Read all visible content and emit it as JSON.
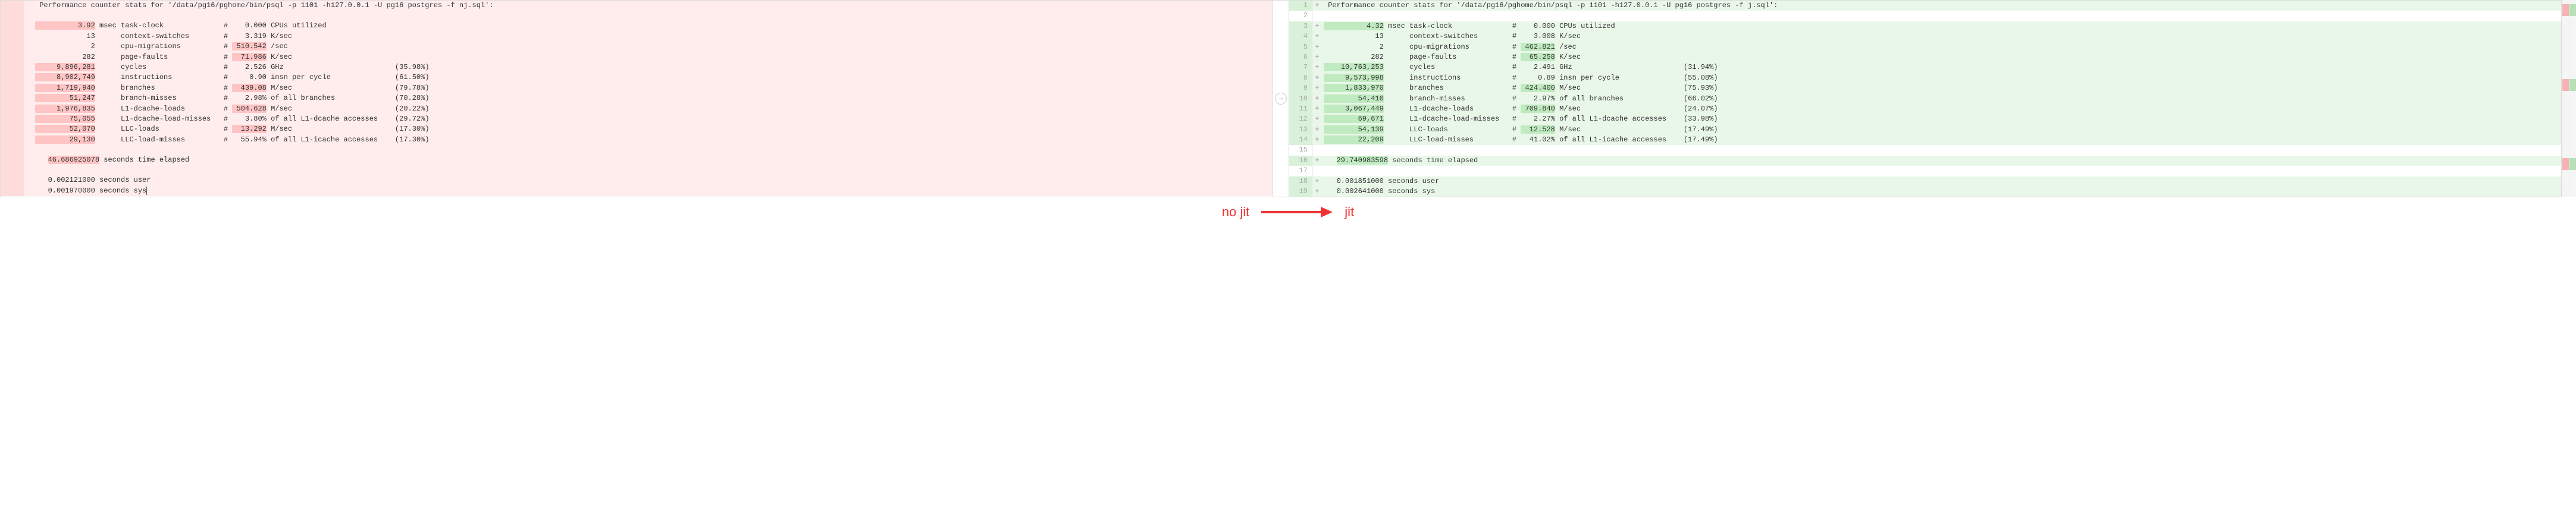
{
  "left": {
    "header": "Performance counter stats for '/data/pg16/pghome/bin/psql -p 1101 -h127.0.0.1 -U pg16 postgres -f nj.sql':",
    "rows": [
      {
        "v1": "3.92",
        "u1": "msec",
        "name": "task-clock",
        "sep": "#",
        "v2": "0.000",
        "u2": "CPUs utilized",
        "pct": "",
        "hl": true
      },
      {
        "v1": "13",
        "u1": "",
        "name": "context-switches",
        "sep": "#",
        "v2": "3.319",
        "u2": "K/sec",
        "pct": ""
      },
      {
        "v1": "2",
        "u1": "",
        "name": "cpu-migrations",
        "sep": "#",
        "v2": "510.542",
        "u2": "/sec",
        "pct": "",
        "hl2": true
      },
      {
        "v1": "282",
        "u1": "",
        "name": "page-faults",
        "sep": "#",
        "v2": "71.986",
        "u2": "K/sec",
        "pct": "",
        "hl2": true
      },
      {
        "v1": "9,896,281",
        "u1": "",
        "name": "cycles",
        "sep": "#",
        "v2": "2.526",
        "u2": "GHz",
        "pct": "(35.98%)",
        "hl": true
      },
      {
        "v1": "8,902,749",
        "u1": "",
        "name": "instructions",
        "sep": "#",
        "v2": "0.90",
        "u2": "insn per cycle",
        "pct": "(61.50%)",
        "hl": true
      },
      {
        "v1": "1,719,940",
        "u1": "",
        "name": "branches",
        "sep": "#",
        "v2": "439.08",
        "u2": "M/sec",
        "pct": "(79.78%)",
        "hl": true,
        "hl2": true
      },
      {
        "v1": "51,247",
        "u1": "",
        "name": "branch-misses",
        "sep": "#",
        "v2": "2.98%",
        "u2": "of all branches",
        "pct": "(70.28%)",
        "hl": true
      },
      {
        "v1": "1,976,835",
        "u1": "",
        "name": "L1-dcache-loads",
        "sep": "#",
        "v2": "504.628",
        "u2": "M/sec",
        "pct": "(20.22%)",
        "hl": true,
        "hl2": true
      },
      {
        "v1": "75,055",
        "u1": "",
        "name": "L1-dcache-load-misses",
        "sep": "#",
        "v2": "3.80%",
        "u2": "of all L1-dcache accesses",
        "pct": "(29.72%)",
        "hl": true
      },
      {
        "v1": "52,070",
        "u1": "",
        "name": "LLC-loads",
        "sep": "#",
        "v2": "13.292",
        "u2": "M/sec",
        "pct": "(17.30%)",
        "hl": true,
        "hl2": true
      },
      {
        "v1": "29,130",
        "u1": "",
        "name": "LLC-load-misses",
        "sep": "#",
        "v2": "55.94%",
        "u2": "of all L1-icache accesses",
        "pct": "(17.30%)",
        "hl": true
      }
    ],
    "elapsed": "46.686925078 seconds time elapsed",
    "user": "0.002121000 seconds user",
    "sys": "0.001970000 seconds sys"
  },
  "right": {
    "header": "Performance counter stats for '/data/pg16/pghome/bin/psql -p 1101 -h127.0.0.1 -U pg16 postgres -f j.sql':",
    "line_numbers": [
      1,
      2,
      3,
      4,
      5,
      6,
      7,
      8,
      9,
      10,
      11,
      12,
      13,
      14,
      15,
      16,
      17,
      18,
      19
    ],
    "rows": [
      {
        "v1": "4.32",
        "u1": "msec",
        "name": "task-clock",
        "sep": "#",
        "v2": "0.000",
        "u2": "CPUs utilized",
        "pct": "",
        "hl": true
      },
      {
        "v1": "13",
        "u1": "",
        "name": "context-switches",
        "sep": "#",
        "v2": "3.008",
        "u2": "K/sec",
        "pct": ""
      },
      {
        "v1": "2",
        "u1": "",
        "name": "cpu-migrations",
        "sep": "#",
        "v2": "462.821",
        "u2": "/sec",
        "pct": "",
        "hl2": true
      },
      {
        "v1": "282",
        "u1": "",
        "name": "page-faults",
        "sep": "#",
        "v2": "65.258",
        "u2": "K/sec",
        "pct": "",
        "hl2": true
      },
      {
        "v1": "10,763,253",
        "u1": "",
        "name": "cycles",
        "sep": "#",
        "v2": "2.491",
        "u2": "GHz",
        "pct": "(31.94%)",
        "hl": true
      },
      {
        "v1": "9,573,998",
        "u1": "",
        "name": "instructions",
        "sep": "#",
        "v2": "0.89",
        "u2": "insn per cycle",
        "pct": "(55.08%)",
        "hl": true
      },
      {
        "v1": "1,833,970",
        "u1": "",
        "name": "branches",
        "sep": "#",
        "v2": "424.400",
        "u2": "M/sec",
        "pct": "(75.93%)",
        "hl": true,
        "hl2": true
      },
      {
        "v1": "54,410",
        "u1": "",
        "name": "branch-misses",
        "sep": "#",
        "v2": "2.97%",
        "u2": "of all branches",
        "pct": "(66.02%)",
        "hl": true
      },
      {
        "v1": "3,067,449",
        "u1": "",
        "name": "L1-dcache-loads",
        "sep": "#",
        "v2": "709.840",
        "u2": "M/sec",
        "pct": "(24.07%)",
        "hl": true,
        "hl2": true
      },
      {
        "v1": "69,671",
        "u1": "",
        "name": "L1-dcache-load-misses",
        "sep": "#",
        "v2": "2.27%",
        "u2": "of all L1-dcache accesses",
        "pct": "(33.98%)",
        "hl": true
      },
      {
        "v1": "54,139",
        "u1": "",
        "name": "LLC-loads",
        "sep": "#",
        "v2": "12.528",
        "u2": "M/sec",
        "pct": "(17.49%)",
        "hl": true,
        "hl2": true
      },
      {
        "v1": "22,209",
        "u1": "",
        "name": "LLC-load-misses",
        "sep": "#",
        "v2": "41.02%",
        "u2": "of all L1-icache accesses",
        "pct": "(17.49%)",
        "hl": true
      }
    ],
    "elapsed": "29.740983598 seconds time elapsed",
    "user": "0.001851000 seconds user",
    "sys": "0.002641000 seconds sys"
  },
  "annotation": {
    "left_label": "no jit",
    "right_label": "jit"
  },
  "mid_button_glyph": "→"
}
